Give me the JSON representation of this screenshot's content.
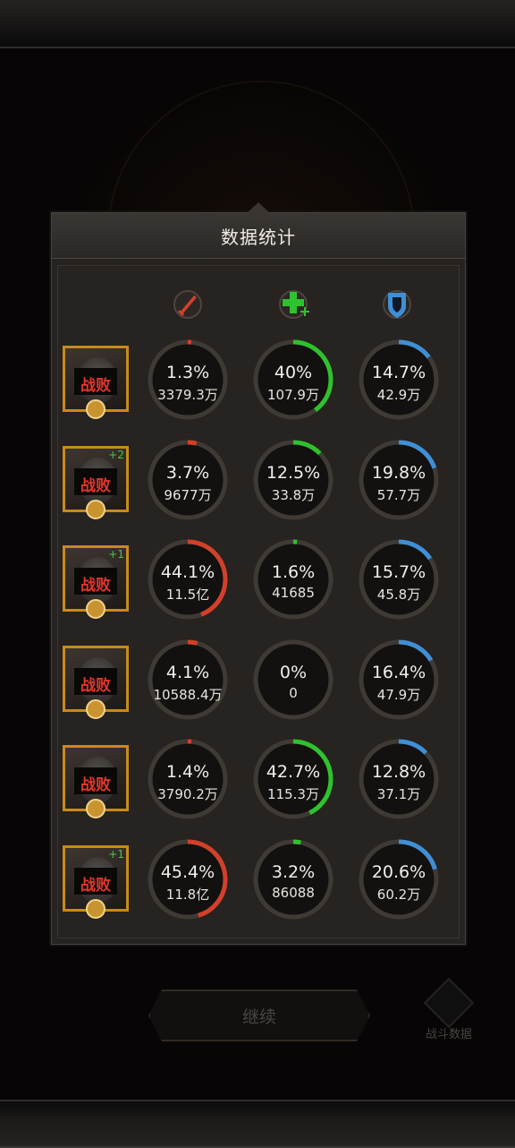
{
  "panel": {
    "title": "数据统计"
  },
  "columns": [
    {
      "icon": "attack-sword-icon",
      "color": "#d2402b"
    },
    {
      "icon": "heal-cross-icon",
      "color": "#2ec22d"
    },
    {
      "icon": "shield-icon",
      "color": "#3f8fd6"
    }
  ],
  "rows": [
    {
      "status": "战败",
      "plus": "",
      "stats": [
        {
          "pct": "1.3%",
          "frac": 0.013,
          "value": "3379.3万"
        },
        {
          "pct": "40%",
          "frac": 0.4,
          "value": "107.9万"
        },
        {
          "pct": "14.7%",
          "frac": 0.147,
          "value": "42.9万"
        }
      ]
    },
    {
      "status": "战败",
      "plus": "+2",
      "stats": [
        {
          "pct": "3.7%",
          "frac": 0.037,
          "value": "9677万"
        },
        {
          "pct": "12.5%",
          "frac": 0.125,
          "value": "33.8万"
        },
        {
          "pct": "19.8%",
          "frac": 0.198,
          "value": "57.7万"
        }
      ]
    },
    {
      "status": "战败",
      "plus": "+1",
      "stats": [
        {
          "pct": "44.1%",
          "frac": 0.441,
          "value": "11.5亿"
        },
        {
          "pct": "1.6%",
          "frac": 0.016,
          "value": "41685"
        },
        {
          "pct": "15.7%",
          "frac": 0.157,
          "value": "45.8万"
        }
      ]
    },
    {
      "status": "战败",
      "plus": "",
      "stats": [
        {
          "pct": "4.1%",
          "frac": 0.041,
          "value": "10588.4万"
        },
        {
          "pct": "0%",
          "frac": 0,
          "value": "0"
        },
        {
          "pct": "16.4%",
          "frac": 0.164,
          "value": "47.9万"
        }
      ]
    },
    {
      "status": "战败",
      "plus": "",
      "stats": [
        {
          "pct": "1.4%",
          "frac": 0.014,
          "value": "3790.2万"
        },
        {
          "pct": "42.7%",
          "frac": 0.427,
          "value": "115.3万"
        },
        {
          "pct": "12.8%",
          "frac": 0.128,
          "value": "37.1万"
        }
      ]
    },
    {
      "status": "战败",
      "plus": "+1",
      "stats": [
        {
          "pct": "45.4%",
          "frac": 0.454,
          "value": "11.8亿"
        },
        {
          "pct": "3.2%",
          "frac": 0.032,
          "value": "86088"
        },
        {
          "pct": "20.6%",
          "frac": 0.206,
          "value": "60.2万"
        }
      ]
    }
  ],
  "footer": {
    "continue_label": "继续",
    "battle_data_label": "战斗数据"
  }
}
